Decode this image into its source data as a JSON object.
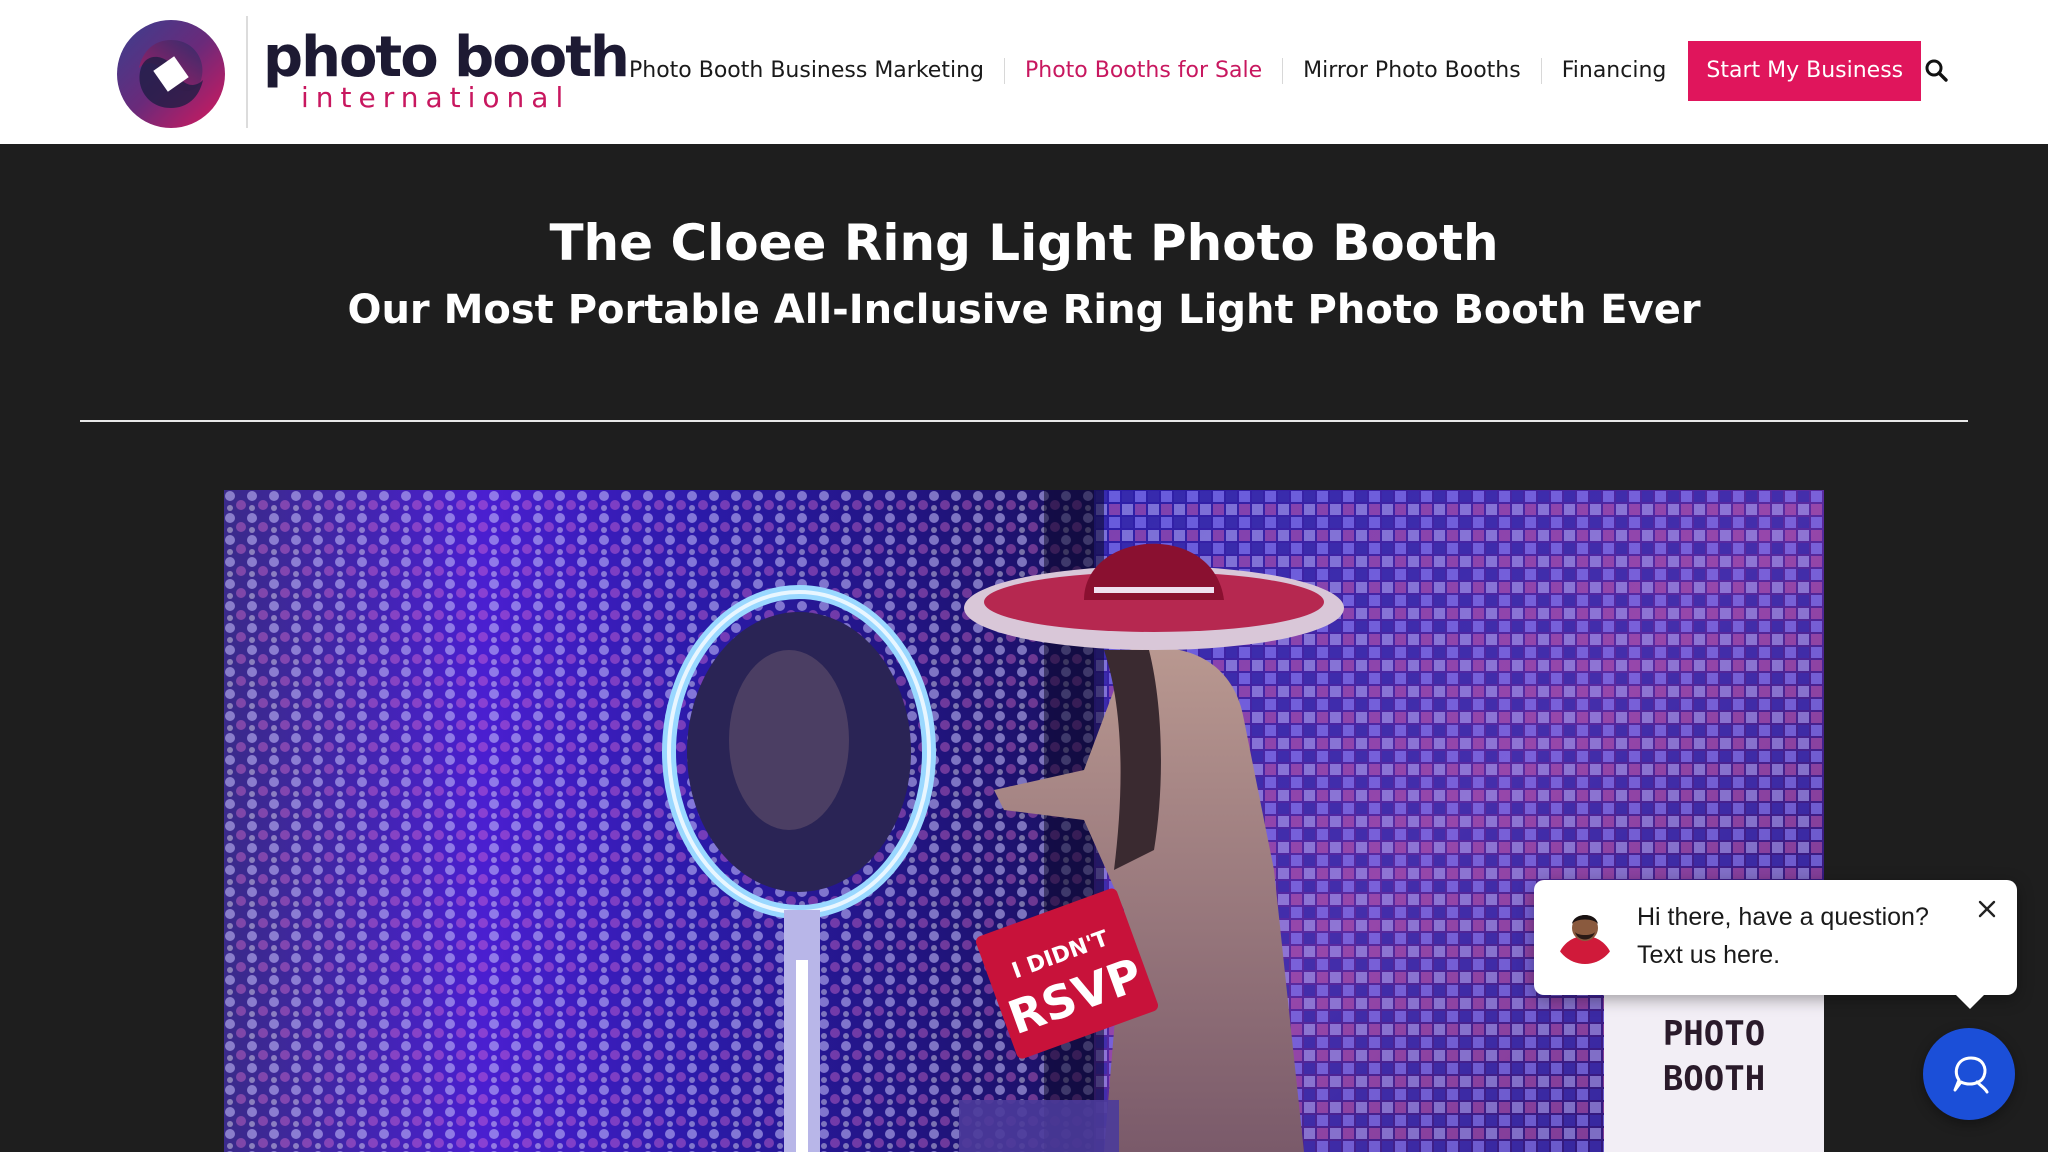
{
  "brand": {
    "name": "photo booth",
    "tagline": "international",
    "accent": "#e0155c",
    "dark": "#1d1a33"
  },
  "nav": {
    "items": [
      {
        "label": "Photo Booth Business Marketing",
        "active": false
      },
      {
        "label": "Photo Booths for Sale",
        "active": true
      },
      {
        "label": "Mirror Photo Booths",
        "active": false
      },
      {
        "label": "Financing",
        "active": false
      }
    ],
    "cta_label": "Start My Business",
    "search_icon": "search-icon"
  },
  "hero": {
    "title": "The Cloee Ring Light Photo Booth",
    "subtitle": "Our Most Portable All-Inclusive Ring Light Photo Booth Ever"
  },
  "photo": {
    "sign_text": "I DIDN'T RSVP",
    "lightbox_line1": "PHOTO",
    "lightbox_line2": "BOOTH"
  },
  "chat": {
    "line1": "Hi there, have a question?",
    "line2": "Text us here.",
    "close_icon": "close-icon",
    "launcher_icon": "chat-icon",
    "launcher_color": "#1b4fd8"
  }
}
